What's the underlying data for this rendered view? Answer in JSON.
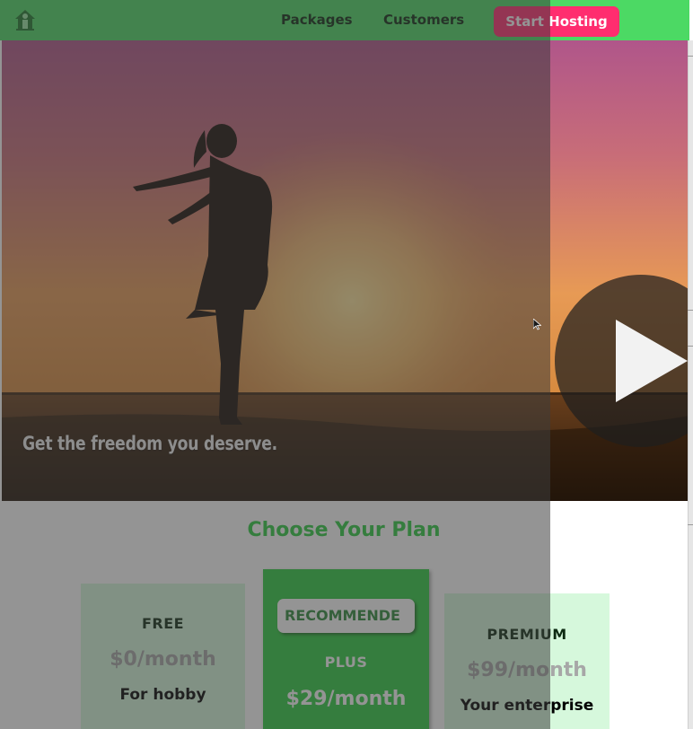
{
  "header": {
    "nav": {
      "packages": "Packages",
      "customers": "Customers"
    },
    "cta_label": "Start Hosting",
    "logo_icon": "house-tree-logo-icon"
  },
  "hero": {
    "tagline": "Get the freedom you deserve.",
    "play_icon": "play-icon"
  },
  "plans": {
    "title": "Choose Your Plan",
    "cards": [
      {
        "name": "FREE",
        "price": "$0/month",
        "description": "For hobby"
      },
      {
        "badge": "RECOMMENDE",
        "name": "PLUS",
        "price": "$29/month"
      },
      {
        "name": "PREMIUM",
        "price": "$99/month",
        "description": "Your enterprise"
      }
    ]
  },
  "colors": {
    "header_bg": "#4cd964",
    "cta_bg": "#ff2d6f",
    "plans_title": "#2ecc40",
    "card_bg": "#d6f8dc",
    "card_highlight": "#2ecc40"
  }
}
